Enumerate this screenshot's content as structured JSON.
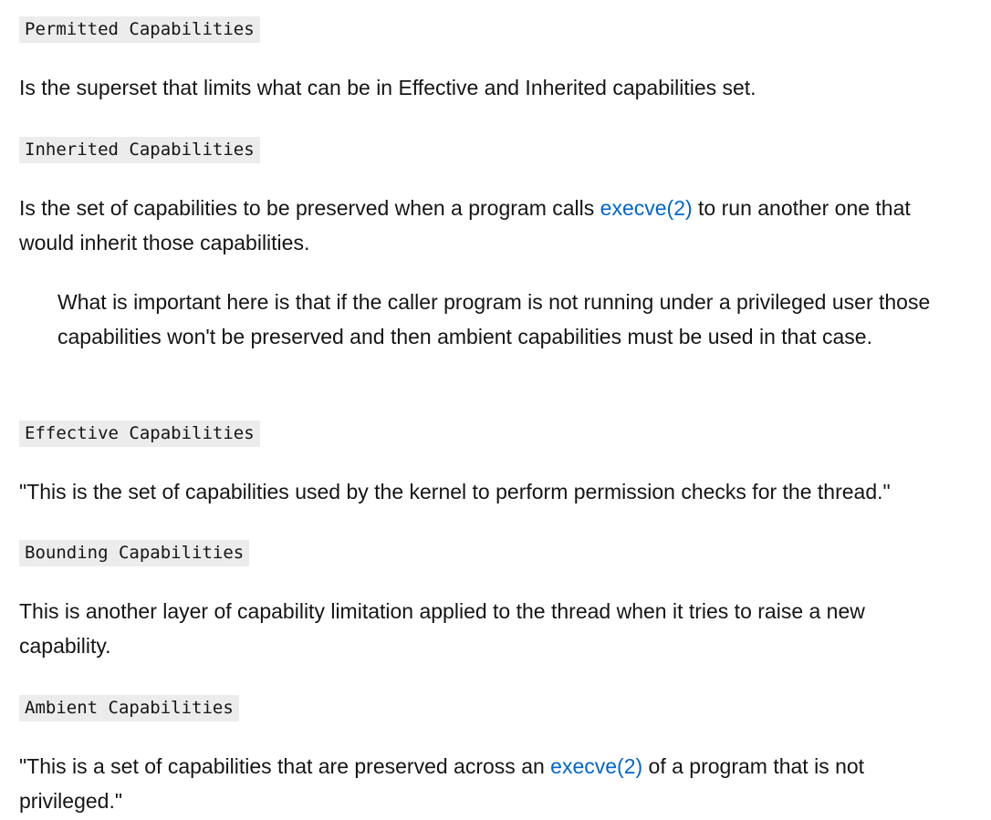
{
  "sections": [
    {
      "term": "Permitted Capabilities",
      "description": "Is the superset that limits what can be in Effective and Inherited capabilities set."
    },
    {
      "term": "Inherited Capabilities",
      "description_before": "Is the set of capabilities to be preserved when a program calls ",
      "link": "execve(2)",
      "description_after": " to run another one that would inherit those capabilities.",
      "note": "What is important here is that if the caller program is not running under a privileged user those capabilities won't be preserved and then ambient capabilities must be used in that case."
    },
    {
      "term": "Effective Capabilities",
      "description": "\"This is the set of capabilities used by the kernel to perform permission checks for the thread.\""
    },
    {
      "term": "Bounding Capabilities",
      "description": "This is another layer of capability limitation applied to the thread when it tries to raise a new capability."
    },
    {
      "term": "Ambient Capabilities",
      "description_before": "\"This is a set of capabilities that are preserved across an ",
      "link": "execve(2)",
      "description_after": " of a program that is not privileged.\""
    }
  ],
  "colors": {
    "link": "#0066cc",
    "code_background": "#ececec",
    "text": "#151515"
  }
}
